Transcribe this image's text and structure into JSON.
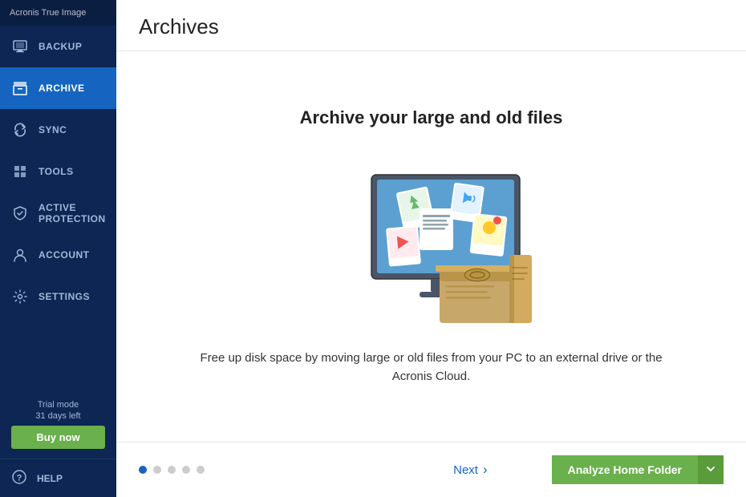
{
  "app": {
    "logo_text": "Acronis True Image"
  },
  "sidebar": {
    "items": [
      {
        "id": "backup",
        "label": "BACKUP",
        "icon": "backup-icon"
      },
      {
        "id": "archive",
        "label": "ARCHIVE",
        "icon": "archive-icon",
        "active": true
      },
      {
        "id": "sync",
        "label": "SYNC",
        "icon": "sync-icon"
      },
      {
        "id": "tools",
        "label": "TOOLS",
        "icon": "tools-icon"
      },
      {
        "id": "active-protection",
        "label": "ACTIVE PROTECTION",
        "icon": "shield-icon"
      },
      {
        "id": "account",
        "label": "ACCOUNT",
        "icon": "account-icon"
      },
      {
        "id": "settings",
        "label": "SETTINGS",
        "icon": "settings-icon"
      }
    ],
    "trial": {
      "line1": "Trial mode",
      "line2": "31 days left",
      "buy_label": "Buy now"
    },
    "help_label": "HELP"
  },
  "main": {
    "title": "Archives",
    "headline": "Archive your large and old files",
    "description": "Free up disk space by moving large or old files from your PC to an external drive or the Acronis Cloud.",
    "pagination": {
      "dots": 5,
      "active": 0
    },
    "next_label": "Next",
    "analyze_label": "Analyze Home Folder"
  }
}
